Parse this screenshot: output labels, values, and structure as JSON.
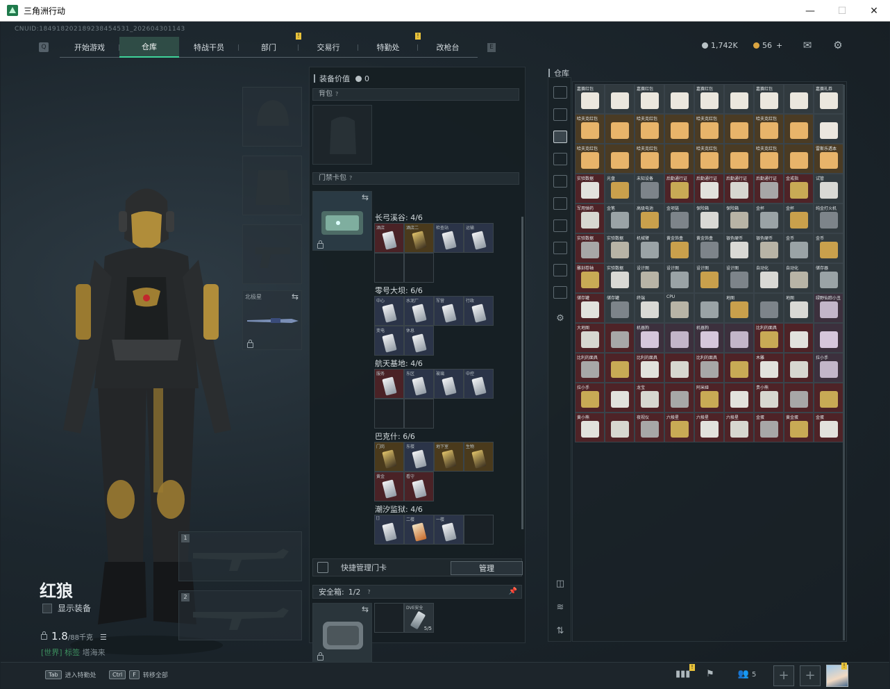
{
  "window": {
    "title": "三角洲行动"
  },
  "uid": "CNUID:184918202189238454531_202604301143",
  "nav": {
    "tabs": [
      "开始游戏",
      "仓库",
      "特战干员",
      "部门",
      "交易行",
      "特勤处",
      "改枪台"
    ],
    "active": "仓库",
    "alerts": [
      "部门",
      "特勤处"
    ]
  },
  "currency": {
    "silver": "1,742K",
    "gold": "56",
    "add": "+"
  },
  "character": {
    "name": "红狼",
    "show_equipment": "显示装备",
    "weight": "1.8",
    "weight_max": "/88千克",
    "status": [
      "[世界]",
      "标签",
      "塔海来"
    ],
    "melee_label": "北极星"
  },
  "equip_panel": {
    "value_label": "装备价值",
    "value": "0",
    "backpack_label": "背包",
    "keycard_label": "门禁卡包",
    "card_groups": [
      {
        "title": "长弓溪谷: 4/6",
        "cells": [
          "酒店",
          "酒店二",
          "检查站",
          "运输"
        ]
      },
      {
        "title": "零号大坝: 6/6",
        "cells": [
          "中心",
          "水泥厂",
          "军营",
          "行政",
          "变电",
          "休息"
        ]
      },
      {
        "title": "航天基地: 4/6",
        "cells": [
          "服务",
          "东区",
          "玻璃",
          "中控"
        ]
      },
      {
        "title": "巴克什: 6/6",
        "cells": [
          "门岗",
          "东楼",
          "地下室",
          "生物",
          "黄金",
          "看守"
        ]
      },
      {
        "title": "潮汐监狱: 4/6",
        "cells": [
          "[]",
          "二楼",
          "一楼",
          "[]"
        ]
      }
    ],
    "quick_manage": "快捷管理门卡",
    "manage_button": "管理",
    "safebox_label": "安全箱:",
    "safebox_value": "1/2",
    "safebox_item": "DVE安全",
    "safebox_count": "5/5"
  },
  "stash": {
    "label": "仓库",
    "items": [
      "嘉赛红包",
      "",
      "嘉赛红包",
      "",
      "嘉赛红包",
      "",
      "嘉赛红包",
      "",
      "嘉赛礼券",
      "哈夫克红包",
      "",
      "哈夫克红包",
      "",
      "哈夫克红包",
      "",
      "哈夫克红包",
      "",
      "",
      "哈夫克红包",
      "",
      "哈夫克红包",
      "",
      "哈夫克红包",
      "",
      "哈夫克红包",
      "",
      "雷斯乐透本",
      "实验数据",
      "光盘",
      "未知设备",
      "后勤通行证",
      "后勤通行证",
      "后勤通行证",
      "后勤通行证",
      "金戒指",
      "试管",
      "军用弹药",
      "金笔",
      "高级电池",
      "金项链",
      "保险箱",
      "保险箱",
      "金杯",
      "金杯",
      "纯金打火机",
      "实验数据",
      "实验数据",
      "机械臂",
      "黄金饰盒",
      "黄金饰盒",
      "银色硬币",
      "银色硬币",
      "金币",
      "金币",
      "雕刻卷轴",
      "实验数据",
      "设计图",
      "设计图",
      "设计图",
      "设计图",
      "自动化",
      "自动化",
      "储存器",
      "储存罐",
      "储存罐",
      "终端",
      "CPU",
      "",
      "地图",
      "",
      "地图",
      "绿野仙踪小丑",
      "大地图",
      "",
      "机器狗",
      "",
      "机器狗",
      "",
      "比利的面具",
      "",
      "",
      "比利的面具",
      "",
      "比利的面具",
      "",
      "比利的面具",
      "",
      "木雕",
      "",
      "拉小手",
      "拉小手",
      "",
      "龙宝",
      "",
      "阿米娅",
      "",
      "贵小熊",
      "",
      "",
      "黄小熊",
      "",
      "夜视仪",
      "六棱星",
      "六棱星",
      "六棱星",
      "金蛋",
      "黄金蛋",
      "金蛋"
    ]
  },
  "bottom": {
    "hint1_key": "Tab",
    "hint1": "进入特勤处",
    "hint2_key1": "Ctrl",
    "hint2_key2": "F",
    "hint2": "转移全部",
    "friends": "5"
  },
  "colors": {
    "accent": "#3fd49a",
    "alert": "#e8c23a",
    "red_cell": "#4e2327"
  }
}
